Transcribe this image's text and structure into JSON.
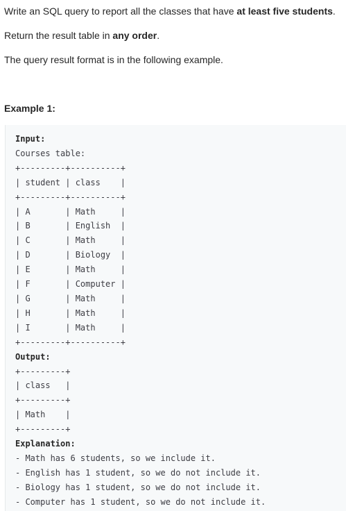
{
  "description": {
    "p1_prefix": "Write an SQL query to report all the classes that have ",
    "p1_bold": "at least five students",
    "p1_suffix": ".",
    "p2_prefix": "Return the result table in ",
    "p2_bold": "any order",
    "p2_suffix": ".",
    "p3": "The query result format is in the following example."
  },
  "example": {
    "heading": "Example 1:",
    "input_label": "Input:",
    "table_name": "Courses table:",
    "input_border": "+---------+----------+",
    "input_header": "| student | class    |",
    "input_rows": [
      "| A       | Math     |",
      "| B       | English  |",
      "| C       | Math     |",
      "| D       | Biology  |",
      "| E       | Math     |",
      "| F       | Computer |",
      "| G       | Math     |",
      "| H       | Math     |",
      "| I       | Math     |"
    ],
    "output_label": "Output:",
    "output_border": "+---------+",
    "output_header": "| class   |",
    "output_rows": [
      "| Math    |"
    ],
    "explanation_label": "Explanation:",
    "explanation_lines": [
      "- Math has 6 students, so we include it.",
      "- English has 1 student, so we do not include it.",
      "- Biology has 1 student, so we do not include it.",
      "- Computer has 1 student, so we do not include it."
    ]
  }
}
